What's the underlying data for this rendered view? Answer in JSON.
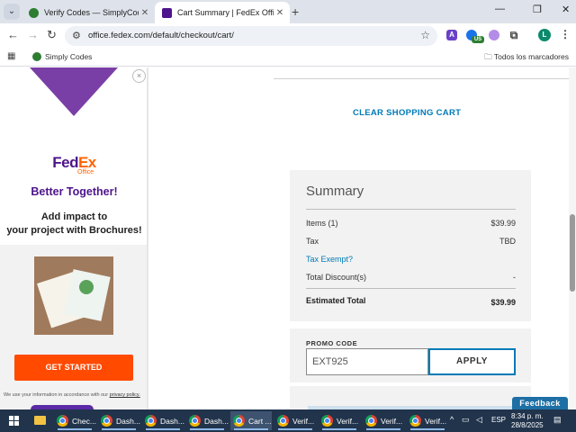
{
  "browser": {
    "tabs": [
      {
        "title": "Verify Codes — SimplyCodes",
        "favicon_color": "#2e7d32",
        "active": false
      },
      {
        "title": "Cart Summary | FedEx Office",
        "favicon_color": "#4d148c",
        "active": true
      }
    ],
    "url": "office.fedex.com/default/checkout/cart/",
    "bookmarks": [
      {
        "label": "Simply Codes"
      }
    ],
    "all_bookmarks_label": "Todos los marcadores",
    "profile_initial": "L",
    "extension_badge": "US"
  },
  "ad": {
    "brand_fed": "Fed",
    "brand_ex": "Ex",
    "brand_sub": "Office",
    "headline": "Better Together!",
    "subhead_line1": "Add impact to",
    "subhead_line2": "your project with Brochures!",
    "cta_label": "GET STARTED",
    "privacy_text": "We use your information in accordance with our ",
    "privacy_link": "privacy policy.",
    "colors": {
      "purple": "#4d148c",
      "orange": "#ff6200",
      "cta": "#ff4a00"
    }
  },
  "cart": {
    "clear_label": "CLEAR SHOPPING CART",
    "summary": {
      "title": "Summary",
      "items_label": "Items (1)",
      "items_value": "$39.99",
      "tax_label": "Tax",
      "tax_value": "TBD",
      "tax_exempt_link": "Tax Exempt?",
      "discount_label": "Total Discount(s)",
      "discount_value": "-",
      "estimated_label": "Estimated Total",
      "estimated_value": "$39.99"
    },
    "promo": {
      "label": "PROMO CODE",
      "value": "EXT925",
      "apply_label": "APPLY"
    },
    "feedback_label": "Feedback",
    "accent_color": "#007ab7"
  },
  "taskbar": {
    "items": [
      {
        "label": "Chec..."
      },
      {
        "label": "Dash..."
      },
      {
        "label": "Dash..."
      },
      {
        "label": "Dash..."
      },
      {
        "label": "Cart ..."
      },
      {
        "label": "Verif..."
      },
      {
        "label": "Verif..."
      },
      {
        "label": "Verif..."
      },
      {
        "label": "Verif..."
      }
    ],
    "language": "ESP",
    "time": "8:34 p. m.",
    "date": "28/8/2025"
  }
}
